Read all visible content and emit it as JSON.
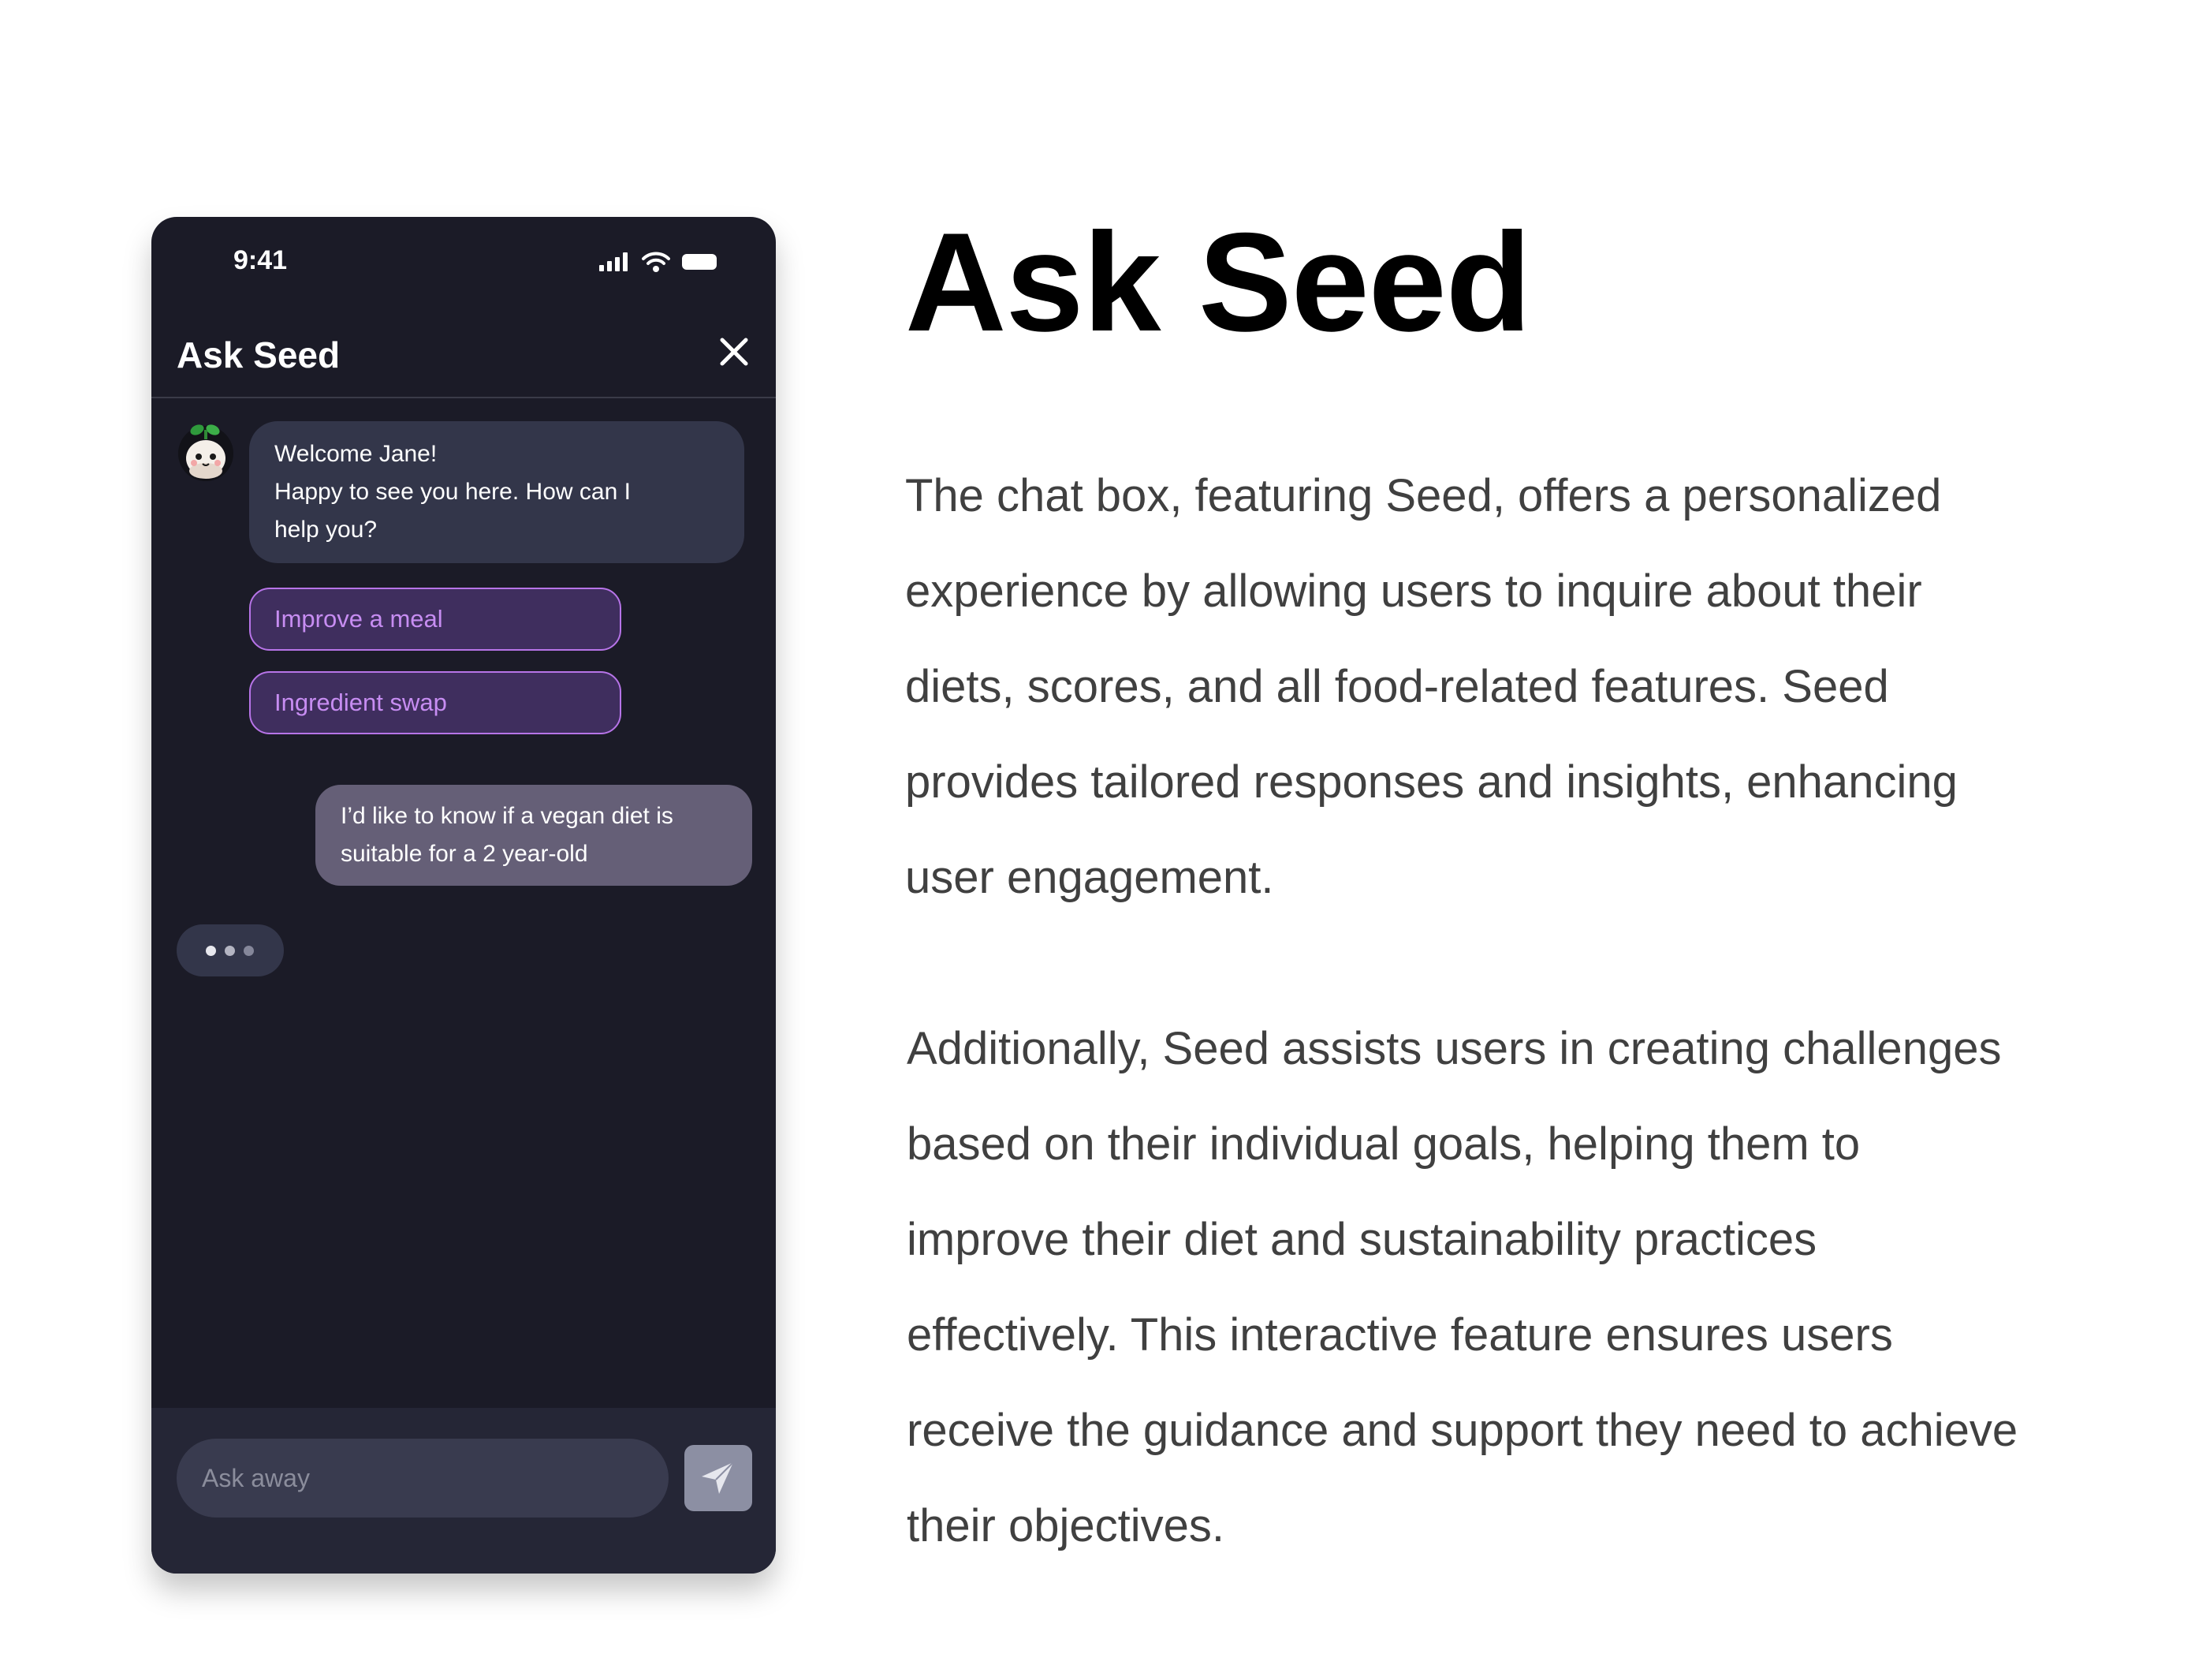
{
  "phone": {
    "status_bar": {
      "time": "9:41",
      "icons": [
        "signal-icon",
        "wifi-icon",
        "battery-icon"
      ]
    },
    "header": {
      "title": "Ask Seed",
      "close_icon": "close-icon"
    },
    "chat": {
      "bot_message": {
        "lines": [
          "Welcome Jane!",
          "Happy to see you here. How can I",
          "help you?"
        ]
      },
      "suggestions": [
        "Improve a meal",
        "Ingredient swap"
      ],
      "user_message": {
        "lines": [
          "I’d like to know if a vegan diet is",
          "suitable for a 2 year-old"
        ]
      },
      "typing_indicator_icon": "typing-dots-icon"
    },
    "input": {
      "placeholder": "Ask away",
      "value": "",
      "send_icon": "send-icon"
    }
  },
  "article": {
    "title": "Ask Seed",
    "paragraph_1_lines": [
      "The chat box, featuring Seed, offers a personalized",
      "experience by allowing users to inquire about their",
      "diets, scores, and all food-related features. Seed",
      "provides tailored responses and insights, enhancing",
      "user engagement."
    ],
    "paragraph_2_lines": [
      "Additionally, Seed assists users in creating challenges",
      "based on their individual goals, helping them to",
      "improve their diet and sustainability practices",
      "effectively. This interactive feature ensures users",
      "receive the guidance and support they need to achieve",
      "their objectives."
    ]
  },
  "colors": {
    "phone_background": "#1b1b27",
    "bot_bubble": "#33364a",
    "user_bubble": "#655f77",
    "chip_border": "#b774e8",
    "chip_fill": "#3f2e5e",
    "chip_text": "#c78df2",
    "input_bar": "#252636",
    "input_field": "#393b4f",
    "send_button": "#8c8fa3",
    "body_text": "#404040"
  }
}
